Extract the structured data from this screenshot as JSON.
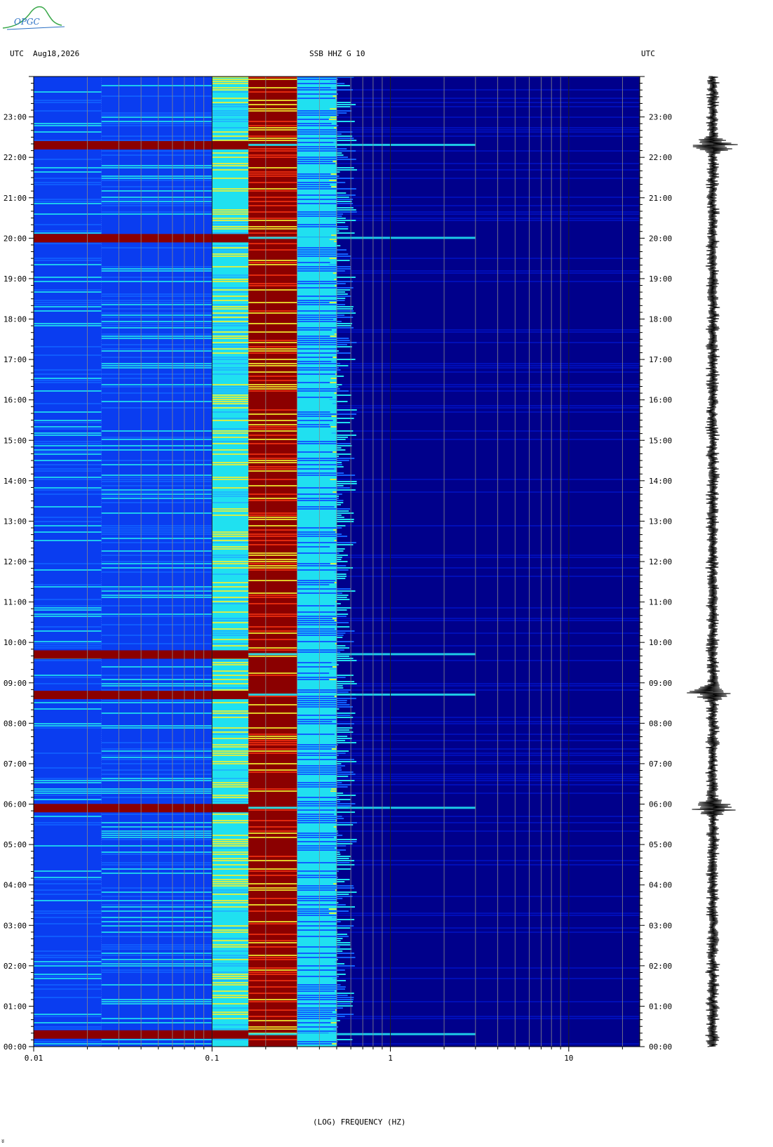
{
  "header": {
    "left_tz": "UTC",
    "date": "Aug18,2026",
    "station": "SSB HHZ G 10",
    "right_tz": "UTC"
  },
  "logo": {
    "text": "OPGC"
  },
  "footer_mark": "ʬ",
  "colors": {
    "dark_blue": "#00008b",
    "blue": "#0a3df0",
    "cyan": "#20e0f0",
    "yellow": "#f0f030",
    "red": "#f03010",
    "dark_red": "#8b0000"
  },
  "chart_data": {
    "type": "heatmap",
    "xlabel": "(LOG) FREQUENCY (HZ)",
    "x_scale": "log",
    "xlim": [
      0.01,
      25
    ],
    "x_ticks": [
      {
        "value": 0.01,
        "label": "0.01"
      },
      {
        "value": 0.1,
        "label": "0.1"
      },
      {
        "value": 1,
        "label": "1"
      },
      {
        "value": 10,
        "label": "10"
      }
    ],
    "ylim_hours": [
      0,
      24
    ],
    "y_ticks": [
      {
        "hour": 0,
        "label": "00:00"
      },
      {
        "hour": 1,
        "label": "01:00"
      },
      {
        "hour": 2,
        "label": "02:00"
      },
      {
        "hour": 3,
        "label": "03:00"
      },
      {
        "hour": 4,
        "label": "04:00"
      },
      {
        "hour": 5,
        "label": "05:00"
      },
      {
        "hour": 6,
        "label": "06:00"
      },
      {
        "hour": 7,
        "label": "07:00"
      },
      {
        "hour": 8,
        "label": "08:00"
      },
      {
        "hour": 9,
        "label": "09:00"
      },
      {
        "hour": 10,
        "label": "10:00"
      },
      {
        "hour": 11,
        "label": "11:00"
      },
      {
        "hour": 12,
        "label": "12:00"
      },
      {
        "hour": 13,
        "label": "13:00"
      },
      {
        "hour": 14,
        "label": "14:00"
      },
      {
        "hour": 15,
        "label": "15:00"
      },
      {
        "hour": 16,
        "label": "16:00"
      },
      {
        "hour": 17,
        "label": "17:00"
      },
      {
        "hour": 18,
        "label": "18:00"
      },
      {
        "hour": 19,
        "label": "19:00"
      },
      {
        "hour": 20,
        "label": "20:00"
      },
      {
        "hour": 21,
        "label": "21:00"
      },
      {
        "hour": 22,
        "label": "22:00"
      },
      {
        "hour": 23,
        "label": "23:00"
      }
    ],
    "grid_x": true,
    "bands": [
      {
        "f_from": 0.01,
        "f_to": 0.024,
        "level": "blue"
      },
      {
        "f_from": 0.024,
        "f_to": 0.1,
        "level": "blue"
      },
      {
        "f_from": 0.1,
        "f_to": 0.16,
        "level": "cyan"
      },
      {
        "f_from": 0.16,
        "f_to": 0.3,
        "level": "dark_red"
      },
      {
        "f_from": 0.3,
        "f_to": 0.5,
        "level": "cyan"
      },
      {
        "f_from": 0.5,
        "f_to": 25,
        "level": "dark_blue"
      }
    ],
    "events_utc_hours": [
      0.3,
      5.9,
      8.7,
      9.7,
      20.0,
      22.3
    ],
    "trace_events_utc_hours": [
      5.9,
      8.75,
      22.3
    ]
  }
}
